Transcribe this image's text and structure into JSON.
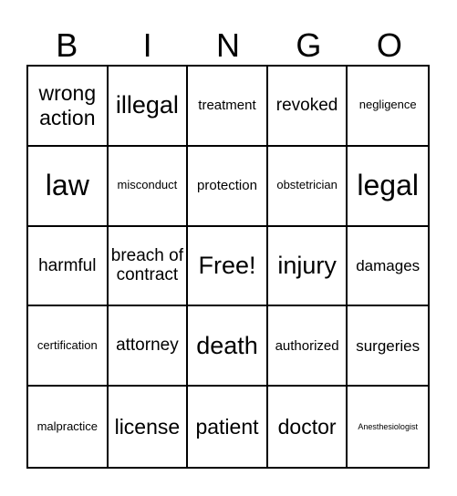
{
  "header": [
    "B",
    "I",
    "N",
    "G",
    "O"
  ],
  "cells": [
    {
      "text": "wrong action",
      "size": "s22"
    },
    {
      "text": "illegal",
      "size": "s27"
    },
    {
      "text": "treatment",
      "size": "s14"
    },
    {
      "text": "revoked",
      "size": "s19"
    },
    {
      "text": "negligence",
      "size": "s12"
    },
    {
      "text": "law",
      "size": "s32"
    },
    {
      "text": "misconduct",
      "size": "s12"
    },
    {
      "text": "protection",
      "size": "s14"
    },
    {
      "text": "obstetrician",
      "size": "s12"
    },
    {
      "text": "legal",
      "size": "s32"
    },
    {
      "text": "harmful",
      "size": "s19"
    },
    {
      "text": "breach of contract",
      "size": "s19"
    },
    {
      "text": "Free!",
      "size": "s27"
    },
    {
      "text": "injury",
      "size": "s27"
    },
    {
      "text": "damages",
      "size": "s16"
    },
    {
      "text": "certification",
      "size": "s12"
    },
    {
      "text": "attorney",
      "size": "s19"
    },
    {
      "text": "death",
      "size": "s27"
    },
    {
      "text": "authorized",
      "size": "s14"
    },
    {
      "text": "surgeries",
      "size": "s16"
    },
    {
      "text": "malpractice",
      "size": "s12"
    },
    {
      "text": "license",
      "size": "s22"
    },
    {
      "text": "patient",
      "size": "s22"
    },
    {
      "text": "doctor",
      "size": "s22"
    },
    {
      "text": "Anesthesiologist",
      "size": "s9"
    }
  ]
}
